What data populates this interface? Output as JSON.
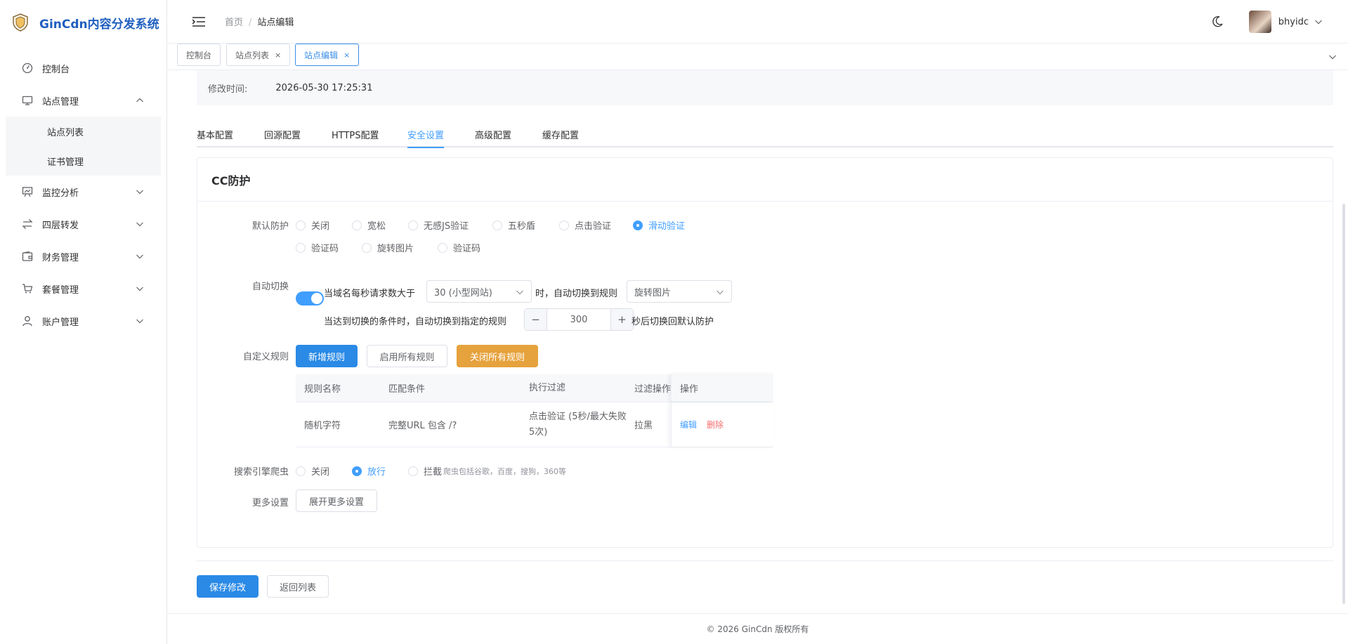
{
  "app": {
    "title": "GinCdn内容分发系统"
  },
  "sidebar": {
    "items": [
      {
        "label": "控制台",
        "icon": "dashboard-icon"
      },
      {
        "label": "站点管理",
        "icon": "monitor-icon",
        "expanded": true,
        "children": [
          {
            "label": "站点列表"
          },
          {
            "label": "证书管理"
          }
        ]
      },
      {
        "label": "监控分析",
        "icon": "chart-icon"
      },
      {
        "label": "四层转发",
        "icon": "forward-icon"
      },
      {
        "label": "财务管理",
        "icon": "wallet-icon"
      },
      {
        "label": "套餐管理",
        "icon": "cart-icon"
      },
      {
        "label": "账户管理",
        "icon": "user-icon"
      }
    ]
  },
  "header": {
    "breadcrumb": {
      "home": "首页",
      "sep": "/",
      "current": "站点编辑"
    },
    "username": "bhyidc"
  },
  "tags": [
    {
      "label": "控制台",
      "closable": false
    },
    {
      "label": "站点列表",
      "closable": true,
      "close": "×"
    },
    {
      "label": "站点编辑",
      "closable": true,
      "close": "×",
      "active": true
    }
  ],
  "modified": {
    "label": "修改时间:",
    "value": "2026-05-30 17:25:31"
  },
  "tabs": [
    {
      "label": "基本配置"
    },
    {
      "label": "回源配置"
    },
    {
      "label": "HTTPS配置"
    },
    {
      "label": "安全设置",
      "active": true
    },
    {
      "label": "高级配置"
    },
    {
      "label": "缓存配置"
    }
  ],
  "cc": {
    "title": "CC防护",
    "default_protect": {
      "label": "默认防护",
      "options": [
        "关闭",
        "宽松",
        "无感JS验证",
        "五秒盾",
        "点击验证",
        "滑动验证",
        "验证码",
        "旋转图片",
        "验证码"
      ],
      "selected": "滑动验证"
    },
    "auto_switch": {
      "label": "自动切换",
      "enabled": true,
      "text1": "当域名每秒请求数大于",
      "threshold": "30 (小型网站)",
      "text2": "时，自动切换到规则",
      "rule": "旋转图片",
      "text3": "当达到切换的条件时，自动切换到指定的规则",
      "seconds": "300",
      "minus": "−",
      "plus": "+",
      "text4": "秒后切换回默认防护"
    },
    "custom_rules": {
      "label": "自定义规则",
      "add": "新增规则",
      "enable_all": "启用所有规则",
      "disable_all": "关闭所有规则",
      "columns": [
        "规则名称",
        "匹配条件",
        "执行过滤",
        "过滤操作",
        "操作"
      ],
      "rows": [
        {
          "name": "随机字符",
          "match": "完整URL 包含 /?",
          "filter": "点击验证 (5秒/最大失败5次)",
          "action": "拉黑",
          "edit": "编辑",
          "delete": "删除"
        }
      ]
    },
    "crawler": {
      "label": "搜索引擎爬虫",
      "options": [
        "关闭",
        "放行",
        "拦截"
      ],
      "selected": "放行",
      "hint": "爬虫包括谷歌，百度，搜狗，360等"
    },
    "more": {
      "label": "更多设置",
      "button": "展开更多设置"
    }
  },
  "actions": {
    "save": "保存修改",
    "back": "返回列表"
  },
  "footer": {
    "text": "© 2026 GinCdn 版权所有"
  },
  "colors": {
    "primary": "#409eff",
    "warning": "#e6a23c",
    "danger": "#f56c6c",
    "brand": "#1f5fbf"
  }
}
